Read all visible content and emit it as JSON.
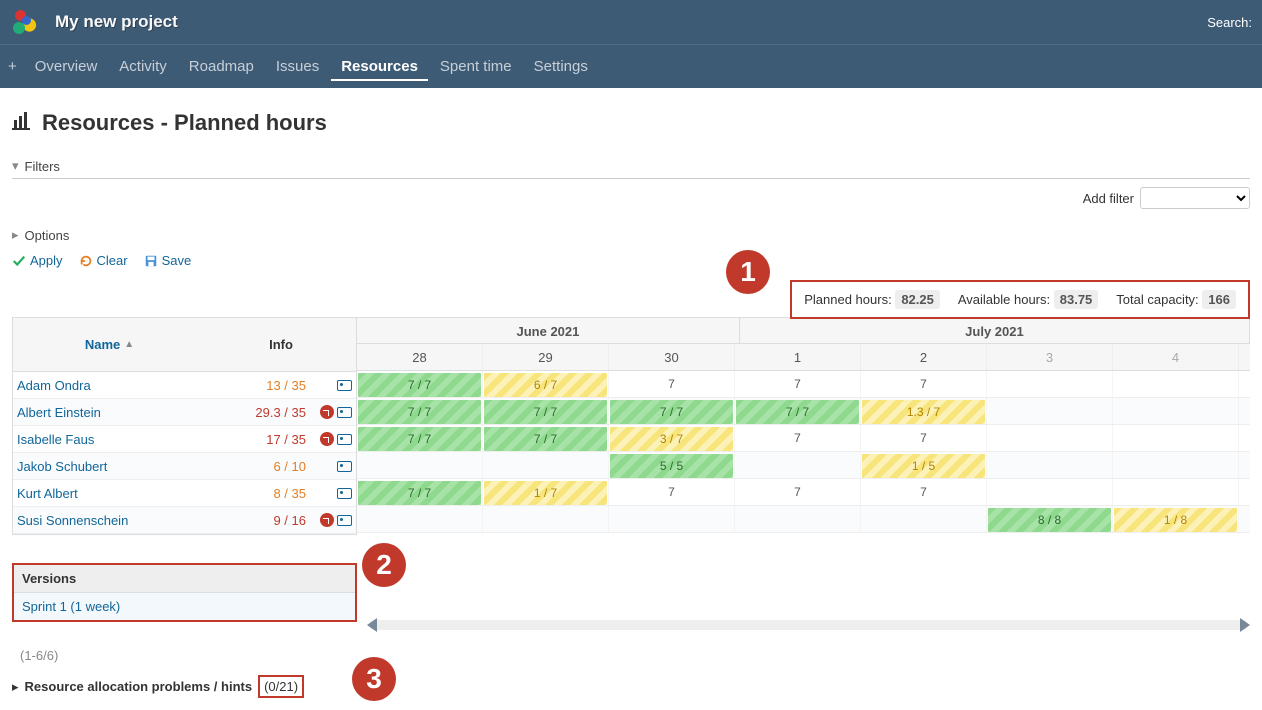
{
  "project_title": "My new project",
  "search_label": "Search:",
  "nav": {
    "overview": "Overview",
    "activity": "Activity",
    "roadmap": "Roadmap",
    "issues": "Issues",
    "resources": "Resources",
    "spent_time": "Spent time",
    "settings": "Settings"
  },
  "page_heading": "Resources - Planned hours",
  "filters_label": "Filters",
  "options_label": "Options",
  "add_filter_label": "Add filter",
  "actions": {
    "apply": "Apply",
    "clear": "Clear",
    "save": "Save"
  },
  "summary": {
    "planned_label": "Planned hours:",
    "planned_value": "82.25",
    "available_label": "Available hours:",
    "available_value": "83.75",
    "capacity_label": "Total capacity:",
    "capacity_value": "166"
  },
  "columns": {
    "name": "Name",
    "info": "Info"
  },
  "months": {
    "june": "June 2021",
    "july": "July 2021"
  },
  "days": {
    "d28": "28",
    "d29": "29",
    "d30": "30",
    "d1": "1",
    "d2": "2",
    "d3": "3",
    "d4": "4"
  },
  "rows": [
    {
      "name": "Adam Ondra",
      "info": "13 / 35",
      "warn": false,
      "cells": [
        {
          "t": "7 / 7",
          "c": "g"
        },
        {
          "t": "6 / 7",
          "c": "y"
        },
        {
          "t": "7",
          "c": ""
        },
        {
          "t": "7",
          "c": ""
        },
        {
          "t": "7",
          "c": ""
        },
        {
          "t": "",
          "c": ""
        },
        {
          "t": "",
          "c": ""
        }
      ]
    },
    {
      "name": "Albert Einstein",
      "info": "29.3 / 35",
      "warn": true,
      "cells": [
        {
          "t": "7 / 7",
          "c": "g"
        },
        {
          "t": "7 / 7",
          "c": "g"
        },
        {
          "t": "7 / 7",
          "c": "g"
        },
        {
          "t": "7 / 7",
          "c": "g"
        },
        {
          "t": "1.3 / 7",
          "c": "y"
        },
        {
          "t": "",
          "c": ""
        },
        {
          "t": "",
          "c": ""
        }
      ]
    },
    {
      "name": "Isabelle Faus",
      "info": "17 / 35",
      "warn": true,
      "cells": [
        {
          "t": "7 / 7",
          "c": "g"
        },
        {
          "t": "7 / 7",
          "c": "g"
        },
        {
          "t": "3 / 7",
          "c": "y"
        },
        {
          "t": "7",
          "c": ""
        },
        {
          "t": "7",
          "c": ""
        },
        {
          "t": "",
          "c": ""
        },
        {
          "t": "",
          "c": ""
        }
      ]
    },
    {
      "name": "Jakob Schubert",
      "info": "6 / 10",
      "warn": false,
      "cells": [
        {
          "t": "",
          "c": ""
        },
        {
          "t": "",
          "c": ""
        },
        {
          "t": "5 / 5",
          "c": "g"
        },
        {
          "t": "",
          "c": ""
        },
        {
          "t": "1 / 5",
          "c": "y"
        },
        {
          "t": "",
          "c": ""
        },
        {
          "t": "",
          "c": ""
        }
      ]
    },
    {
      "name": "Kurt Albert",
      "info": "8 / 35",
      "warn": false,
      "cells": [
        {
          "t": "7 / 7",
          "c": "g"
        },
        {
          "t": "1 / 7",
          "c": "y"
        },
        {
          "t": "7",
          "c": ""
        },
        {
          "t": "7",
          "c": ""
        },
        {
          "t": "7",
          "c": ""
        },
        {
          "t": "",
          "c": ""
        },
        {
          "t": "",
          "c": ""
        }
      ]
    },
    {
      "name": "Susi Sonnenschein",
      "info": "9 / 16",
      "warn": true,
      "cells": [
        {
          "t": "",
          "c": ""
        },
        {
          "t": "",
          "c": ""
        },
        {
          "t": "",
          "c": ""
        },
        {
          "t": "",
          "c": ""
        },
        {
          "t": "",
          "c": ""
        },
        {
          "t": "8 / 8",
          "c": "g"
        },
        {
          "t": "1 / 8",
          "c": "y"
        }
      ]
    }
  ],
  "versions": {
    "header": "Versions",
    "item": "Sprint 1 (1 week)"
  },
  "pagination": "(1-6/6)",
  "hints": {
    "label": "Resource allocation problems / hints",
    "count": "(0/21)"
  },
  "annot": {
    "b1": "1",
    "b2": "2",
    "b3": "3"
  }
}
